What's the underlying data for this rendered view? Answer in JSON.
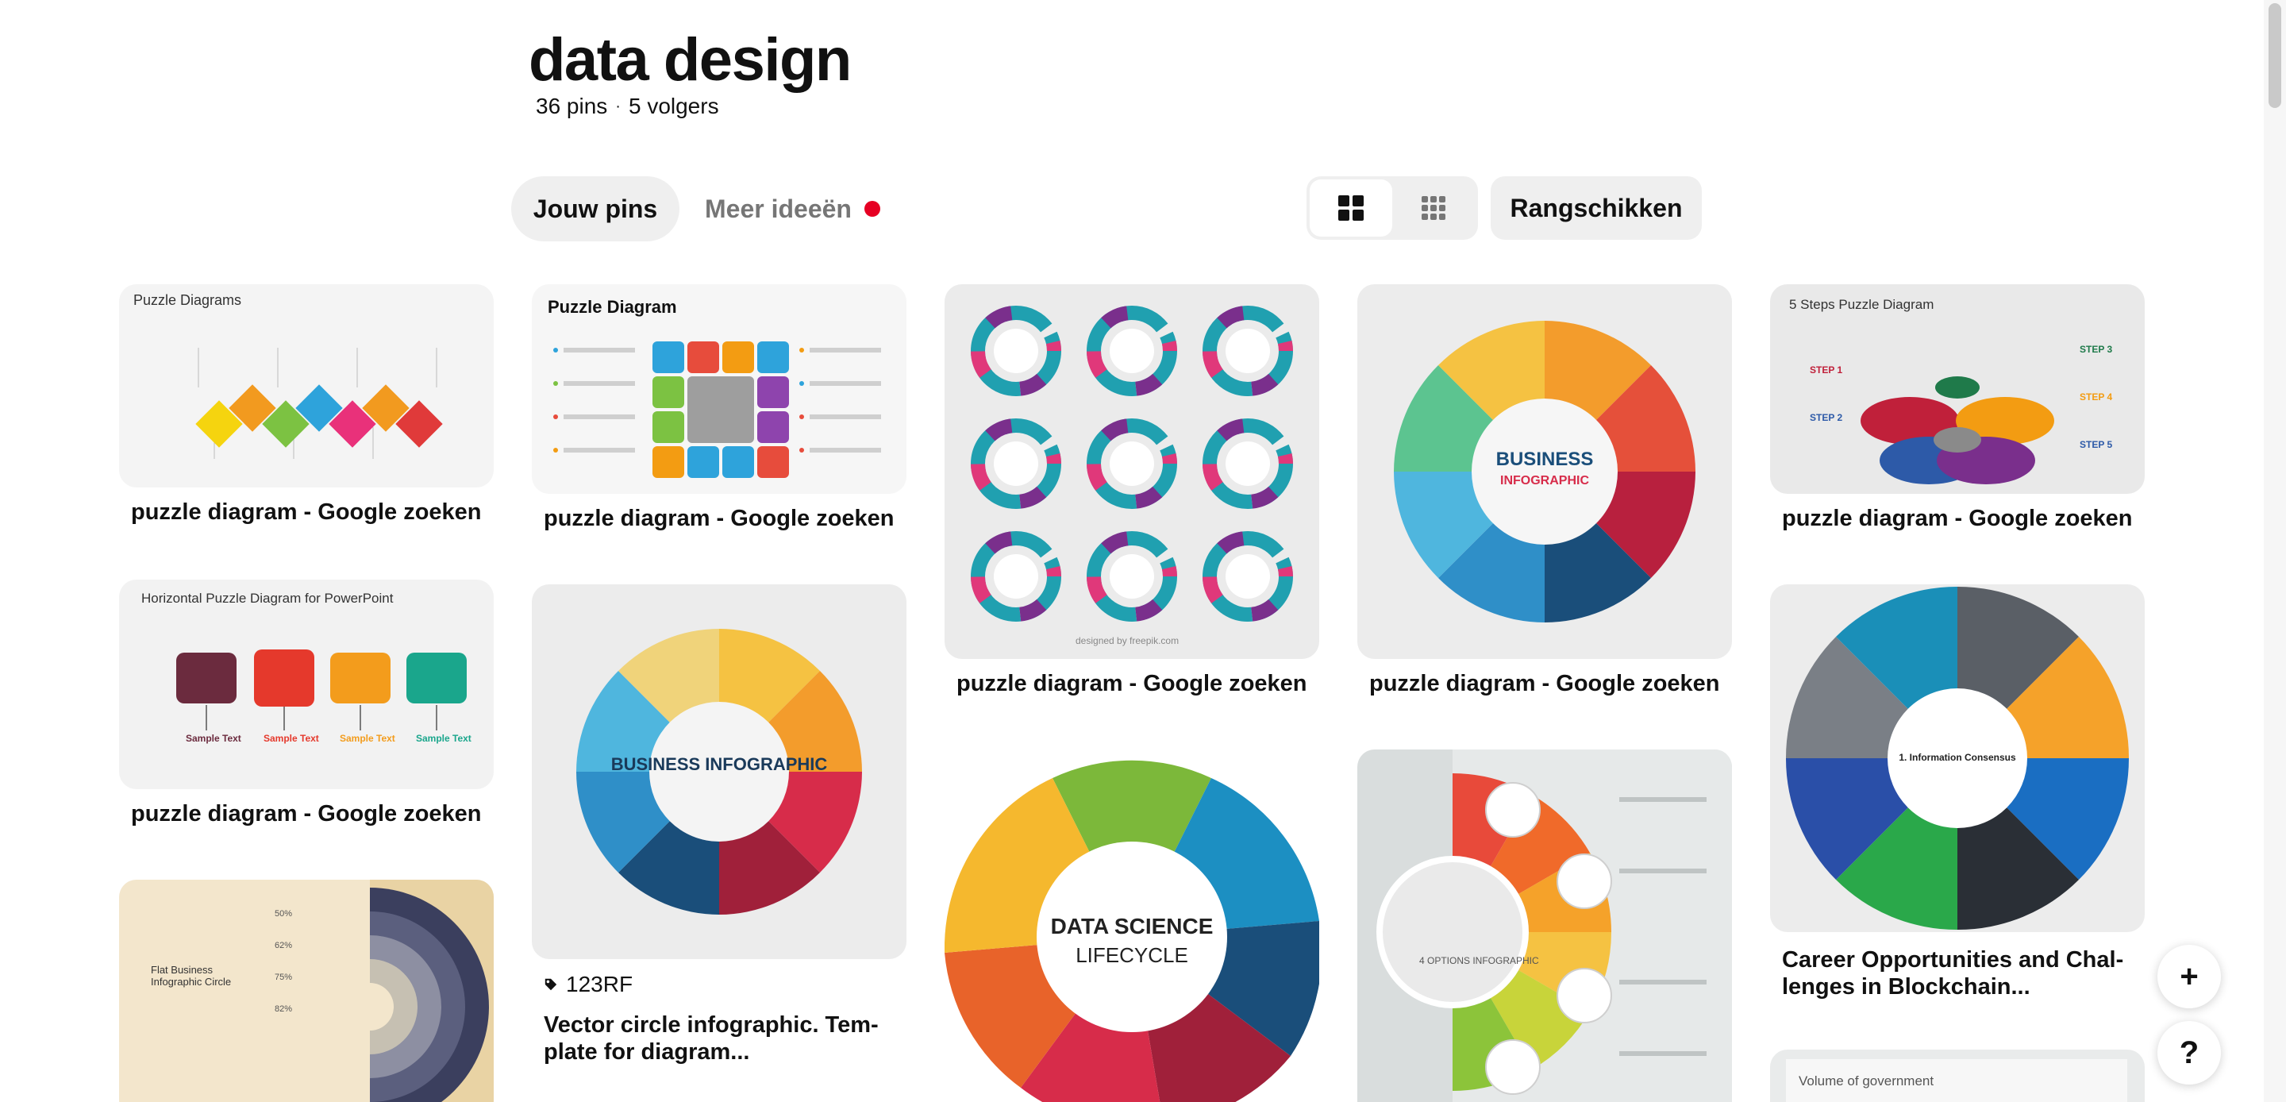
{
  "board": {
    "title": "data design",
    "pins_count": "36 pins",
    "separator": "·",
    "followers": "5 volgers"
  },
  "tabs": {
    "your_pins": "Jouw pins",
    "more_ideas": "Meer ideeën"
  },
  "toolbar": {
    "sort_label": "Rangschikken",
    "view_default_icon": "large-grid-icon",
    "view_compact_icon": "compact-grid-icon"
  },
  "pins": [
    {
      "title": "puzzle diagram - Google zoeken",
      "img_caption": "Puzzle Diagrams"
    },
    {
      "title": "puzzle diagram - Google zoeken",
      "img_caption": "Horizontal Puzzle Diagram for PowerPoint"
    },
    {
      "title": "",
      "img_caption": "Flat Business Infographic Circle",
      "img_values": [
        "50%",
        "62%",
        "75%",
        "82%"
      ]
    },
    {
      "title": "puzzle diagram - Google zoeken",
      "img_caption": "Puzzle Diagram"
    },
    {
      "source": "123RF",
      "title": "Vector circle infographic. Tem-plate for diagram...",
      "img_caption": "BUSINESS INFOGRAPHIC"
    },
    {
      "title": "puzzle diagram - Google zoeken",
      "img_caption": "designed by freepik.com"
    },
    {
      "title": "",
      "img_caption_line1": "DATA SCIENCE",
      "img_caption_line2": "LIFECYCLE"
    },
    {
      "title": "puzzle diagram - Google zoeken",
      "img_caption_line1": "BUSINESS",
      "img_caption_line2": "INFOGRAPHIC"
    },
    {
      "title": "",
      "img_caption": "4 OPTIONS INFOGRAPHIC"
    },
    {
      "title": "puzzle diagram - Google zoeken",
      "img_caption": "5 Steps Puzzle Diagram"
    },
    {
      "title": "Career Opportunities and Chal-lenges in Blockchain...",
      "img_caption": "1. Information Consensus"
    },
    {
      "title": "",
      "img_caption": "Volume of government"
    }
  ],
  "floating": {
    "add_label": "+",
    "help_label": "?"
  },
  "colors": {
    "accent_red": "#e60023",
    "pill_bg": "#efefef"
  }
}
